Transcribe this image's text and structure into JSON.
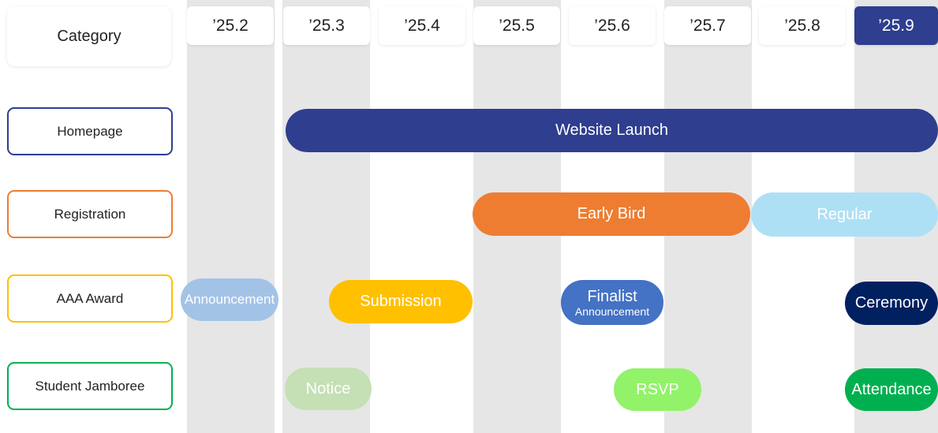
{
  "header": {
    "category_label": "Category"
  },
  "months": [
    {
      "label": "’25.2",
      "active": false
    },
    {
      "label": "’25.3",
      "active": false
    },
    {
      "label": "’25.4",
      "active": false
    },
    {
      "label": "’25.5",
      "active": false
    },
    {
      "label": "’25.6",
      "active": false
    },
    {
      "label": "’25.7",
      "active": false
    },
    {
      "label": "’25.8",
      "active": false
    },
    {
      "label": "’25.9",
      "active": true
    }
  ],
  "categories": [
    {
      "label": "Homepage",
      "color": "#2f3e8f"
    },
    {
      "label": "Registration",
      "color": "#ee7d31"
    },
    {
      "label": "AAA Award",
      "color": "#ffc000"
    },
    {
      "label": "Student Jamboree",
      "color": "#00b050"
    }
  ],
  "timeline": {
    "homepage": [
      {
        "label": "Website Launch",
        "color": "#2f3e8f"
      }
    ],
    "registration": [
      {
        "label": "Early Bird",
        "color": "#ee7d31"
      },
      {
        "label": "Regular",
        "color": "#aee0f5"
      }
    ],
    "award": [
      {
        "label": "Announcement",
        "color": "#a3c3e6"
      },
      {
        "label": "Submission",
        "color": "#ffc000"
      },
      {
        "label": "Finalist",
        "sublabel": "Announcement",
        "color": "#4472c4"
      },
      {
        "label": "Ceremony",
        "color": "#002060"
      }
    ],
    "jamboree": [
      {
        "label": "Notice",
        "color": "#c5e0b4"
      },
      {
        "label": "RSVP",
        "color": "#92f26a"
      },
      {
        "label": "Attendance",
        "color": "#00b050"
      }
    ]
  }
}
